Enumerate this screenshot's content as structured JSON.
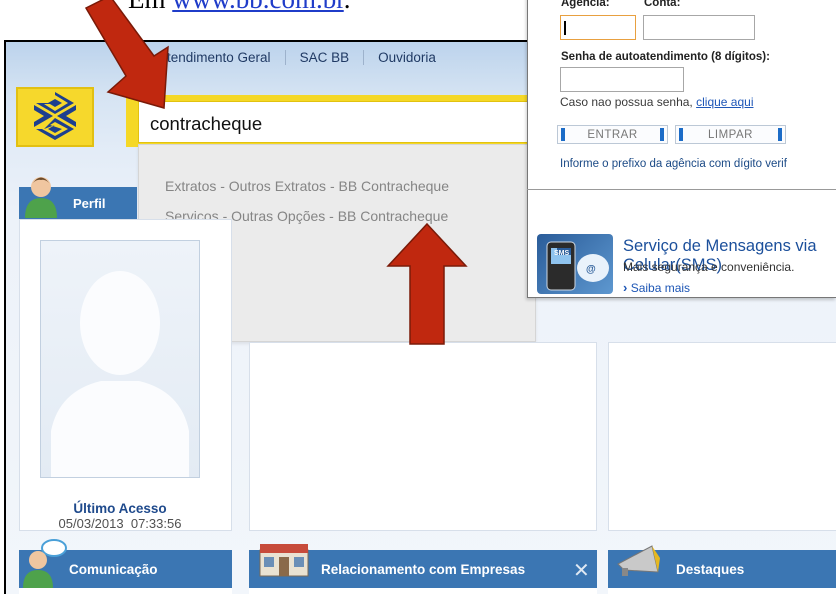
{
  "caption": {
    "prefix": "Em ",
    "link": "www.bb.com.br",
    "suffix": "."
  },
  "topnav": {
    "items": [
      "Atendimento Geral",
      "SAC BB",
      "Ouvidoria"
    ]
  },
  "search": {
    "value": "contracheque"
  },
  "dropdown": {
    "items": [
      "Extratos - Outros Extratos - BB Contracheque",
      "Serviços - Outras Opções - BB Contracheque"
    ]
  },
  "perfil": {
    "title": "Perfil",
    "last_access_label": "Último Acesso",
    "last_access_date": "05/03/2013",
    "last_access_time": "07:33:56"
  },
  "bottom_bars": {
    "comunicacao": "Comunicação",
    "empresas": "Relacionamento com Empresas",
    "destaques": "Destaques"
  },
  "login": {
    "agencia_label": "Agência:",
    "conta_label": "Conta:",
    "senha_label": "Senha de autoatendimento (8 dígitos):",
    "no_password_text": "Caso nao possua senha,",
    "no_password_link": "clique aqui",
    "enter_button": "ENTRAR",
    "clear_button": "LIMPAR",
    "info_text": "Informe o prefixo da agência com dígito verif"
  },
  "sms": {
    "title_line1": "Serviço de Mensagens via",
    "title_line2": "Celular(SMS)",
    "subtitle": "Mais segurança e conveniência.",
    "more": "Saiba mais",
    "icon_text": "SMS"
  },
  "colors": {
    "brand_yellow": "#f5d826",
    "brand_blue": "#3b76b3",
    "arrow_red": "#c0280f"
  }
}
